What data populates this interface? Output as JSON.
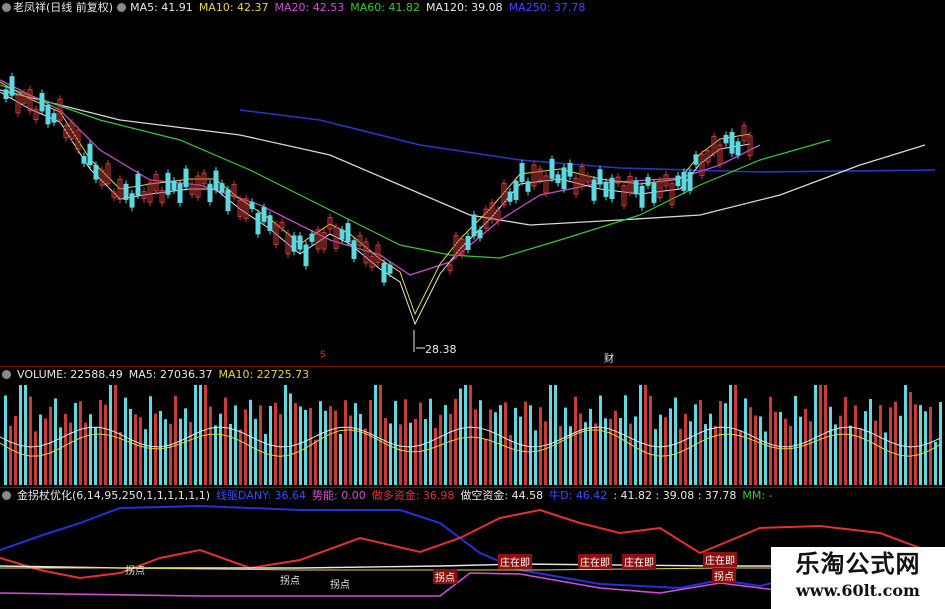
{
  "main_panel": {
    "title": "老凤祥(日线 前复权)",
    "ma": [
      {
        "text": "MA5: 41.91",
        "color": "#e8e8e8"
      },
      {
        "text": "MA10: 42.37",
        "color": "#e6d44a"
      },
      {
        "text": "MA20: 42.53",
        "color": "#d24fd6"
      },
      {
        "text": "MA60: 41.82",
        "color": "#34c934"
      },
      {
        "text": "MA120: 39.08",
        "color": "#e8e8e8"
      },
      {
        "text": "MA250: 37.78",
        "color": "#3a4bff"
      }
    ],
    "low_label": "28.38",
    "markers": [
      {
        "text": "S"
      },
      {
        "text": "财"
      }
    ]
  },
  "volume_panel": {
    "title": "VOLUME: 22588.49",
    "ma": [
      {
        "text": "MA5: 27036.37",
        "color": "#e8e8e8"
      },
      {
        "text": "MA10: 22725.73",
        "color": "#e6d44a"
      }
    ]
  },
  "indicator_panel": {
    "title": "金拐杖优化(6,14,95,250,1,1,1,1,1,1)",
    "items": [
      {
        "text": "线驱DANY: 36.64",
        "color": "#3a4bff"
      },
      {
        "text": "势能: 0.00",
        "color": "#d24fd6"
      },
      {
        "text": "做多资金: 36.98",
        "color": "#e33030"
      },
      {
        "text": "做空资金: 44.58",
        "color": "#e8e8e8"
      },
      {
        "text": "牛D: 46.42",
        "color": "#3a4bff"
      },
      {
        "text": ": 41.82 : 39.08 : 37.78",
        "color": "#e8e8e8"
      },
      {
        "text": "MM: -",
        "color": "#34c934"
      }
    ],
    "badges": [
      {
        "text": "拐点",
        "type": "plain"
      },
      {
        "text": "拐点",
        "type": "plain"
      },
      {
        "text": "拐点",
        "type": "plain"
      },
      {
        "text": "拐点",
        "type": "red"
      },
      {
        "text": "庄在即",
        "type": "red"
      },
      {
        "text": "庄在即",
        "type": "red"
      },
      {
        "text": "庄在即",
        "type": "red"
      },
      {
        "text": "庄在即",
        "type": "red"
      },
      {
        "text": "拐点",
        "type": "red"
      }
    ]
  },
  "watermark": {
    "cn": "乐淘公式网",
    "url": "www.60lt.com"
  },
  "colors": {
    "up": "#c83b3b",
    "down": "#5fd8e0",
    "bg": "#000000",
    "separator": "#7a1010"
  }
}
